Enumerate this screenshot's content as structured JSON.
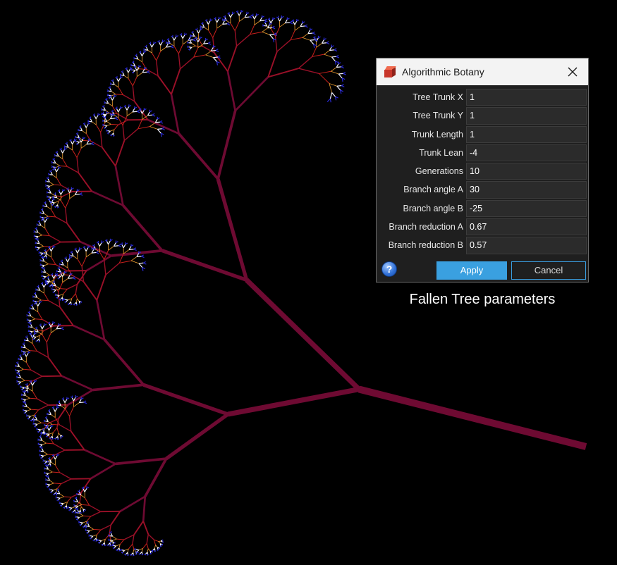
{
  "colors": {
    "background": "#000000",
    "trunk": "#6e0a32",
    "mid_branch": "#c8201c",
    "twig": "#f0a030",
    "leaf_white": "#f4f4ff",
    "leaf_blue": "#2a2ad8",
    "accent": "#3aa0e0"
  },
  "dialog": {
    "title": "Algorithmic Botany",
    "icon": "cube-app-icon",
    "fields": [
      {
        "label": "Tree Trunk X",
        "value": "1"
      },
      {
        "label": "Tree Trunk Y",
        "value": "1"
      },
      {
        "label": "Trunk Length",
        "value": "1"
      },
      {
        "label": "Trunk Lean",
        "value": "-4"
      },
      {
        "label": "Generations",
        "value": "10"
      },
      {
        "label": "Branch angle A",
        "value": "30"
      },
      {
        "label": "Branch angle B",
        "value": "-25"
      },
      {
        "label": "Branch reduction A",
        "value": "0.67"
      },
      {
        "label": "Branch reduction B",
        "value": "0.57"
      }
    ],
    "help_label": "?",
    "apply_label": "Apply",
    "cancel_label": "Cancel"
  },
  "caption": "Fallen Tree parameters"
}
